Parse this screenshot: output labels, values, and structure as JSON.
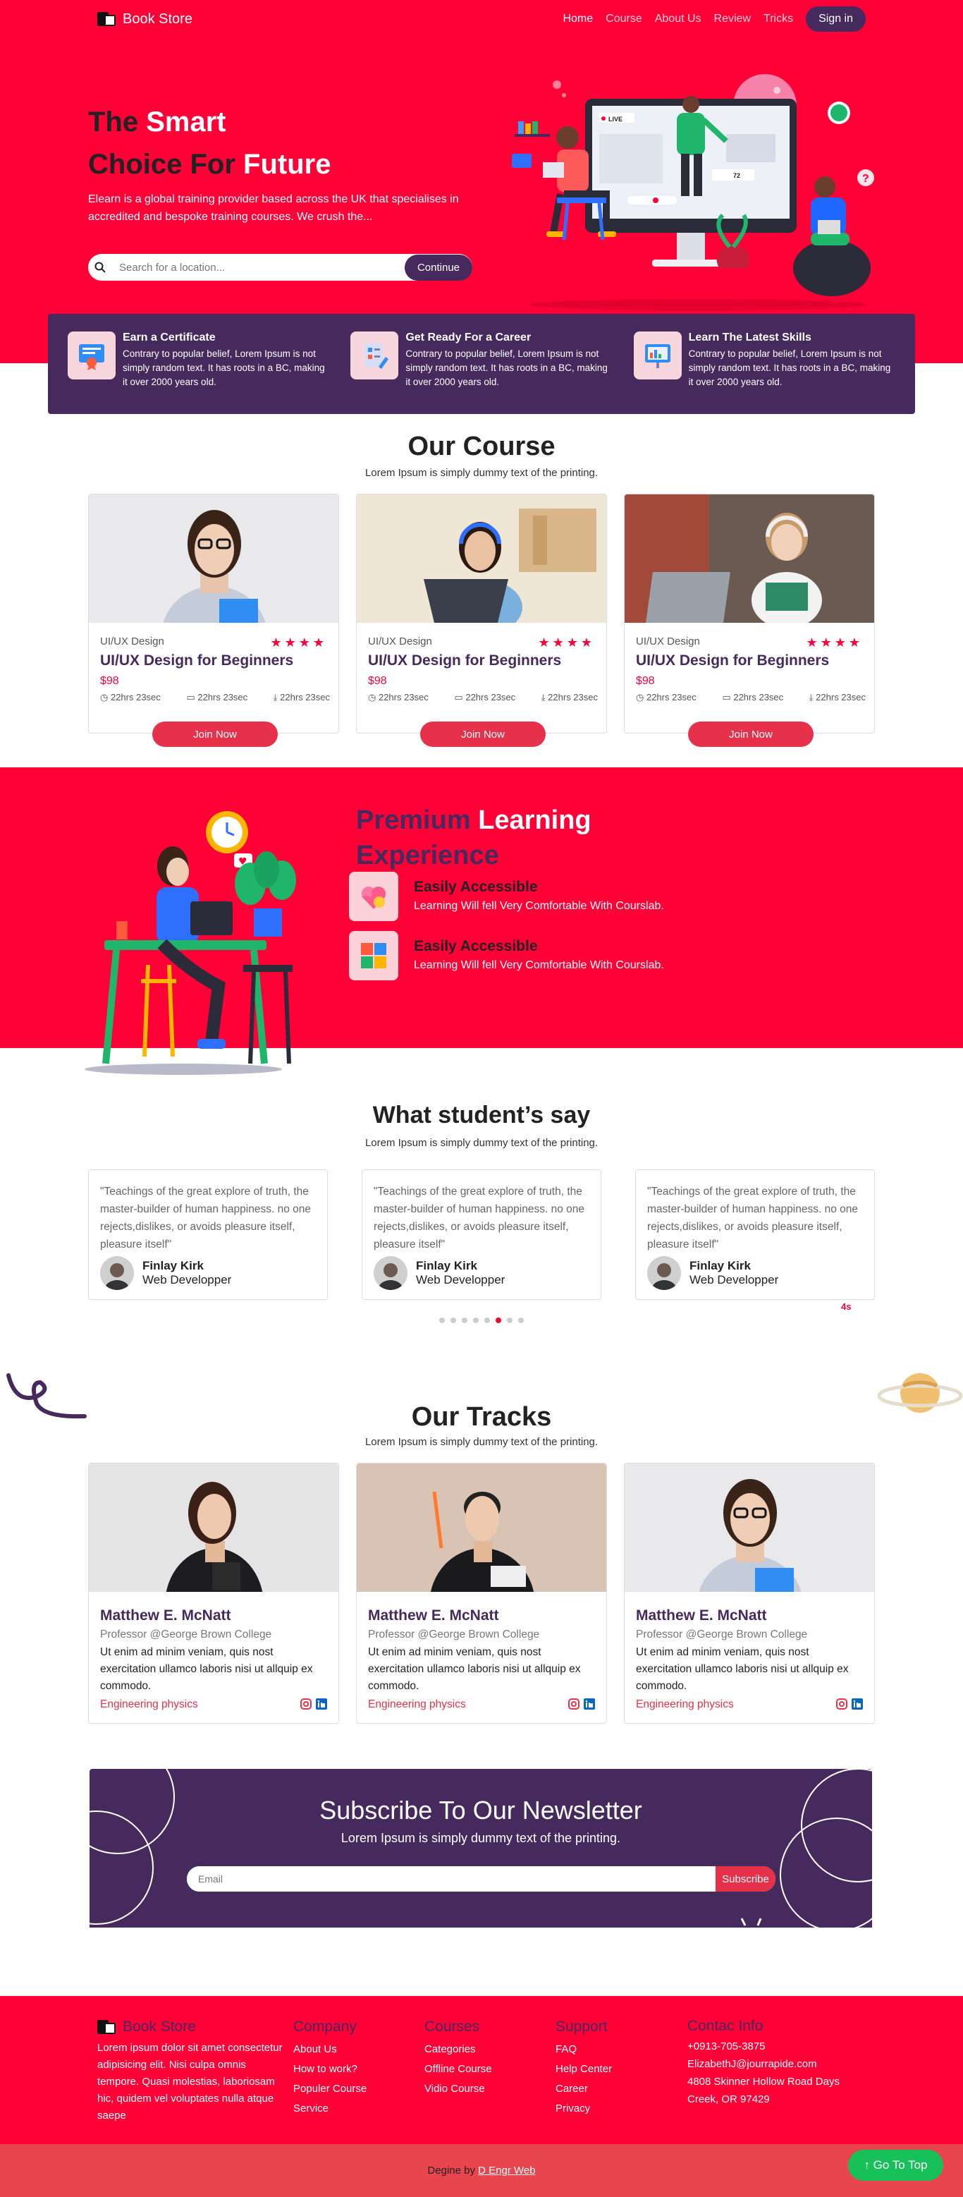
{
  "brand": {
    "name": "Book Store"
  },
  "nav": {
    "links": [
      "Home",
      "Course",
      "About Us",
      "Review",
      "Tricks"
    ],
    "signin": "Sign in"
  },
  "hero": {
    "title_dark1": "The",
    "title_light1": "Smart",
    "title_dark2": "Choice For",
    "title_light2": "Future",
    "description": "Elearn is a global training provider based across the UK that specialises in accredited and bespoke training courses. We crush the...",
    "search_placeholder": "Search for a location...",
    "search_button": "Continue",
    "live_badge": "LIVE",
    "viewer_count": "72"
  },
  "features": [
    {
      "title": "Earn a Certificate",
      "text": "Contrary to popular belief, Lorem Ipsum is not simply random text. It has roots in a BC, making it over 2000 years old."
    },
    {
      "title": "Get Ready For a Career",
      "text": "Contrary to popular belief, Lorem Ipsum is not simply random text. It has roots in a BC, making it over 2000 years old."
    },
    {
      "title": "Learn The Latest Skills",
      "text": "Contrary to popular belief, Lorem Ipsum is not simply random text. It has roots in a BC, making it over 2000 years old."
    }
  ],
  "courses_section": {
    "title": "Our Course",
    "subtitle": "Lorem Ipsum is simply dummy text of the printing."
  },
  "courses": [
    {
      "category": "UI/UX Design",
      "stars": "★★★★",
      "title": "UI/UX Design for Beginners",
      "price": "$98",
      "m1": "22hrs 23sec",
      "m2": "22hrs 23sec",
      "m3": "22hrs 23sec",
      "join": "Join Now"
    },
    {
      "category": "UI/UX Design",
      "stars": "★★★★",
      "title": "UI/UX Design for Beginners",
      "price": "$98",
      "m1": "22hrs 23sec",
      "m2": "22hrs 23sec",
      "m3": "22hrs 23sec",
      "join": "Join Now"
    },
    {
      "category": "UI/UX Design",
      "stars": "★★★★",
      "title": "UI/UX Design for Beginners",
      "price": "$98",
      "m1": "22hrs 23sec",
      "m2": "22hrs 23sec",
      "m3": "22hrs 23sec",
      "join": "Join Now"
    }
  ],
  "premium": {
    "title_dark1": "Premium",
    "title_light": "Learning",
    "title_dark2": "Experience",
    "items": [
      {
        "title": "Easily Accessible",
        "text": "Learning Will fell Very Comfortable With Courslab."
      },
      {
        "title": "Easily Accessible",
        "text": "Learning Will fell Very Comfortable With Courslab."
      }
    ]
  },
  "testimonials_section": {
    "title": "What student’s say",
    "subtitle": "Lorem Ipsum is simply dummy text of the printing.",
    "timer": "4s"
  },
  "testimonials": [
    {
      "quote": "\"Teachings of the great explore of truth, the master-builder of human happiness. no one rejects,dislikes, or avoids pleasure itself, pleasure itself\"",
      "name": "Finlay Kirk",
      "role": "Web Developper"
    },
    {
      "quote": "\"Teachings of the great explore of truth, the master-builder of human happiness. no one rejects,dislikes, or avoids pleasure itself, pleasure itself\"",
      "name": "Finlay Kirk",
      "role": "Web Developper"
    },
    {
      "quote": "\"Teachings of the great explore of truth, the master-builder of human happiness. no one rejects,dislikes, or avoids pleasure itself, pleasure itself\"",
      "name": "Finlay Kirk",
      "role": "Web Developper"
    }
  ],
  "carousel": {
    "dot_count": 8,
    "active_index": 5
  },
  "tracks_section": {
    "title": "Our Tracks",
    "subtitle": "Lorem Ipsum is simply dummy text of the printing."
  },
  "tracks": [
    {
      "name": "Matthew E. McNatt",
      "org": "Professor @George Brown College",
      "bio": "Ut enim ad minim veniam, quis nost exercitation ullamco laboris nisi ut allquip ex commodo.",
      "dept": "Engineering physics"
    },
    {
      "name": "Matthew E. McNatt",
      "org": "Professor @George Brown College",
      "bio": "Ut enim ad minim veniam, quis nost exercitation ullamco laboris nisi ut allquip ex commodo.",
      "dept": "Engineering physics"
    },
    {
      "name": "Matthew E. McNatt",
      "org": "Professor @George Brown College",
      "bio": "Ut enim ad minim veniam, quis nost exercitation ullamco laboris nisi ut allquip ex commodo.",
      "dept": "Engineering physics"
    }
  ],
  "newsletter": {
    "title": "Subscribe To Our Newsletter",
    "subtitle": "Lorem Ipsum is simply dummy text of the printing.",
    "placeholder": "Email",
    "button": "Subscribe"
  },
  "footer": {
    "about": "Lorem ipsum dolor sit amet consectetur adipisicing elit. Nisi culpa omnis tempore. Quasi molestias, laboriosam hic, quidem vel voluptates nulla atque saepe",
    "company": {
      "title": "Company",
      "links": [
        "About Us",
        "How to work?",
        "Populer Course",
        "Service"
      ]
    },
    "courses": {
      "title": "Courses",
      "links": [
        "Categories",
        "Offline Course",
        "Vidio Course"
      ]
    },
    "support": {
      "title": "Support",
      "links": [
        "FAQ",
        "Help Center",
        "Career",
        "Privacy"
      ]
    },
    "contact": {
      "title": "Contac Info",
      "lines": [
        "+0913-705-3875",
        "ElizabethJ@jourrapide.com",
        "4808 Skinner Hollow Road Days",
        "Creek, OR 97429"
      ]
    }
  },
  "copyright": {
    "prefix": "Degine by",
    "author": "D Engr Web"
  },
  "gotop": "Go To Top",
  "colors": {
    "primary_red": "#ff0037",
    "purple": "#472a5d",
    "accent_red": "#e7314b",
    "green": "#18c05a"
  }
}
